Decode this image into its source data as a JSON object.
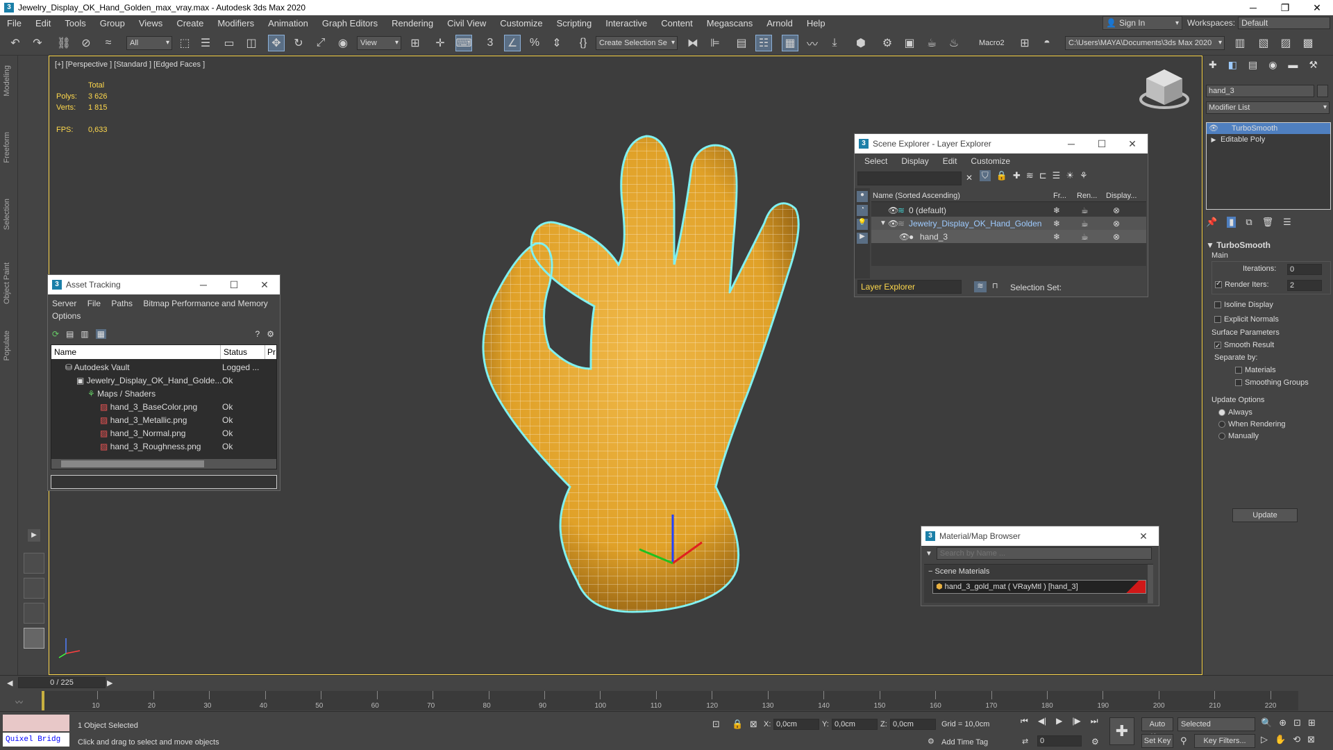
{
  "window": {
    "title": "Jewelry_Display_OK_Hand_Golden_max_vray.max - Autodesk 3ds Max 2020",
    "app_icon": "3"
  },
  "menu": [
    "File",
    "Edit",
    "Tools",
    "Group",
    "Views",
    "Create",
    "Modifiers",
    "Animation",
    "Graph Editors",
    "Rendering",
    "Civil View",
    "Customize",
    "Scripting",
    "Interactive",
    "Content",
    "Megascans",
    "Arnold",
    "Help"
  ],
  "account": {
    "sign_in": "Sign In",
    "workspaces_label": "Workspaces:",
    "workspace": "Default"
  },
  "toolbar": {
    "filter": "All",
    "ref_coord": "View",
    "selection_set": "Create Selection Se",
    "macro": "Macro2",
    "project_path": "C:\\Users\\MAYA\\Documents\\3ds Max 2020"
  },
  "left_tabs": [
    "Modeling",
    "Freeform",
    "Selection",
    "Object Paint",
    "Populate"
  ],
  "viewport": {
    "label": "[+] [Perspective ] [Standard ] [Edged Faces ]",
    "stats": {
      "total_label": "Total",
      "polys_label": "Polys:",
      "polys": "3 626",
      "verts_label": "Verts:",
      "verts": "1 815",
      "fps_label": "FPS:",
      "fps": "0,633"
    }
  },
  "scene_explorer": {
    "title": "Scene Explorer - Layer Explorer",
    "menu": [
      "Select",
      "Display",
      "Edit",
      "Customize"
    ],
    "columns": {
      "name": "Name (Sorted Ascending)",
      "freeze": "Fr...",
      "render": "Ren...",
      "display": "Display..."
    },
    "rows": [
      {
        "name": "0 (default)"
      },
      {
        "name": "Jewelry_Display_OK_Hand_Golden"
      },
      {
        "name": "hand_3"
      }
    ],
    "footer_mode": "Layer Explorer",
    "selection_set_label": "Selection Set:"
  },
  "asset_tracking": {
    "title": "Asset Tracking",
    "menu": [
      "Server",
      "File",
      "Paths",
      "Bitmap Performance and Memory",
      "Options"
    ],
    "columns": {
      "name": "Name",
      "status": "Status",
      "p": "Pr"
    },
    "rows": [
      {
        "name": "Autodesk Vault",
        "status": "Logged ..."
      },
      {
        "name": "Jewelry_Display_OK_Hand_Golde...",
        "status": "Ok"
      },
      {
        "name": "Maps / Shaders",
        "status": ""
      },
      {
        "name": "hand_3_BaseColor.png",
        "status": "Ok"
      },
      {
        "name": "hand_3_Metallic.png",
        "status": "Ok"
      },
      {
        "name": "hand_3_Normal.png",
        "status": "Ok"
      },
      {
        "name": "hand_3_Roughness.png",
        "status": "Ok"
      }
    ]
  },
  "material_browser": {
    "title": "Material/Map Browser",
    "search_placeholder": "Search by Name ...",
    "group": "Scene Materials",
    "material": "hand_3_gold_mat  ( VRayMtl )  [hand_3]"
  },
  "command_panel": {
    "object_name": "hand_3",
    "modifier_list": "Modifier List",
    "stack": [
      "TurboSmooth",
      "Editable Poly"
    ],
    "rollout_title": "TurboSmooth",
    "main_label": "Main",
    "iterations_label": "Iterations:",
    "iterations": "0",
    "render_iters_label": "Render Iters:",
    "render_iters": "2",
    "isoline": "Isoline Display",
    "explicit_normals": "Explicit Normals",
    "surface_params": "Surface Parameters",
    "smooth_result": "Smooth Result",
    "separate_by": "Separate by:",
    "materials": "Materials",
    "smoothing_groups": "Smoothing Groups",
    "update_options": "Update Options",
    "always": "Always",
    "when_rendering": "When Rendering",
    "manually": "Manually",
    "update_button": "Update"
  },
  "timeline": {
    "frame_readout": "0 / 225",
    "ticks": [
      "10",
      "20",
      "30",
      "40",
      "50",
      "60",
      "70",
      "80",
      "90",
      "100",
      "110",
      "120",
      "130",
      "140",
      "150",
      "160",
      "170",
      "180",
      "190",
      "200",
      "210",
      "220"
    ]
  },
  "status": {
    "quixel": "Quixel Bridg",
    "selected": "1 Object Selected",
    "hint": "Click and drag to select and move objects",
    "x_label": "X:",
    "x": "0,0cm",
    "y_label": "Y:",
    "y": "0,0cm",
    "z_label": "Z:",
    "z": "0,0cm",
    "grid": "Grid = 10,0cm",
    "add_time_tag": "Add Time Tag",
    "auto_key": "Auto Key",
    "set_key": "Set Key",
    "selected_dd": "Selected",
    "key_filters": "Key Filters...",
    "frame": "0"
  }
}
